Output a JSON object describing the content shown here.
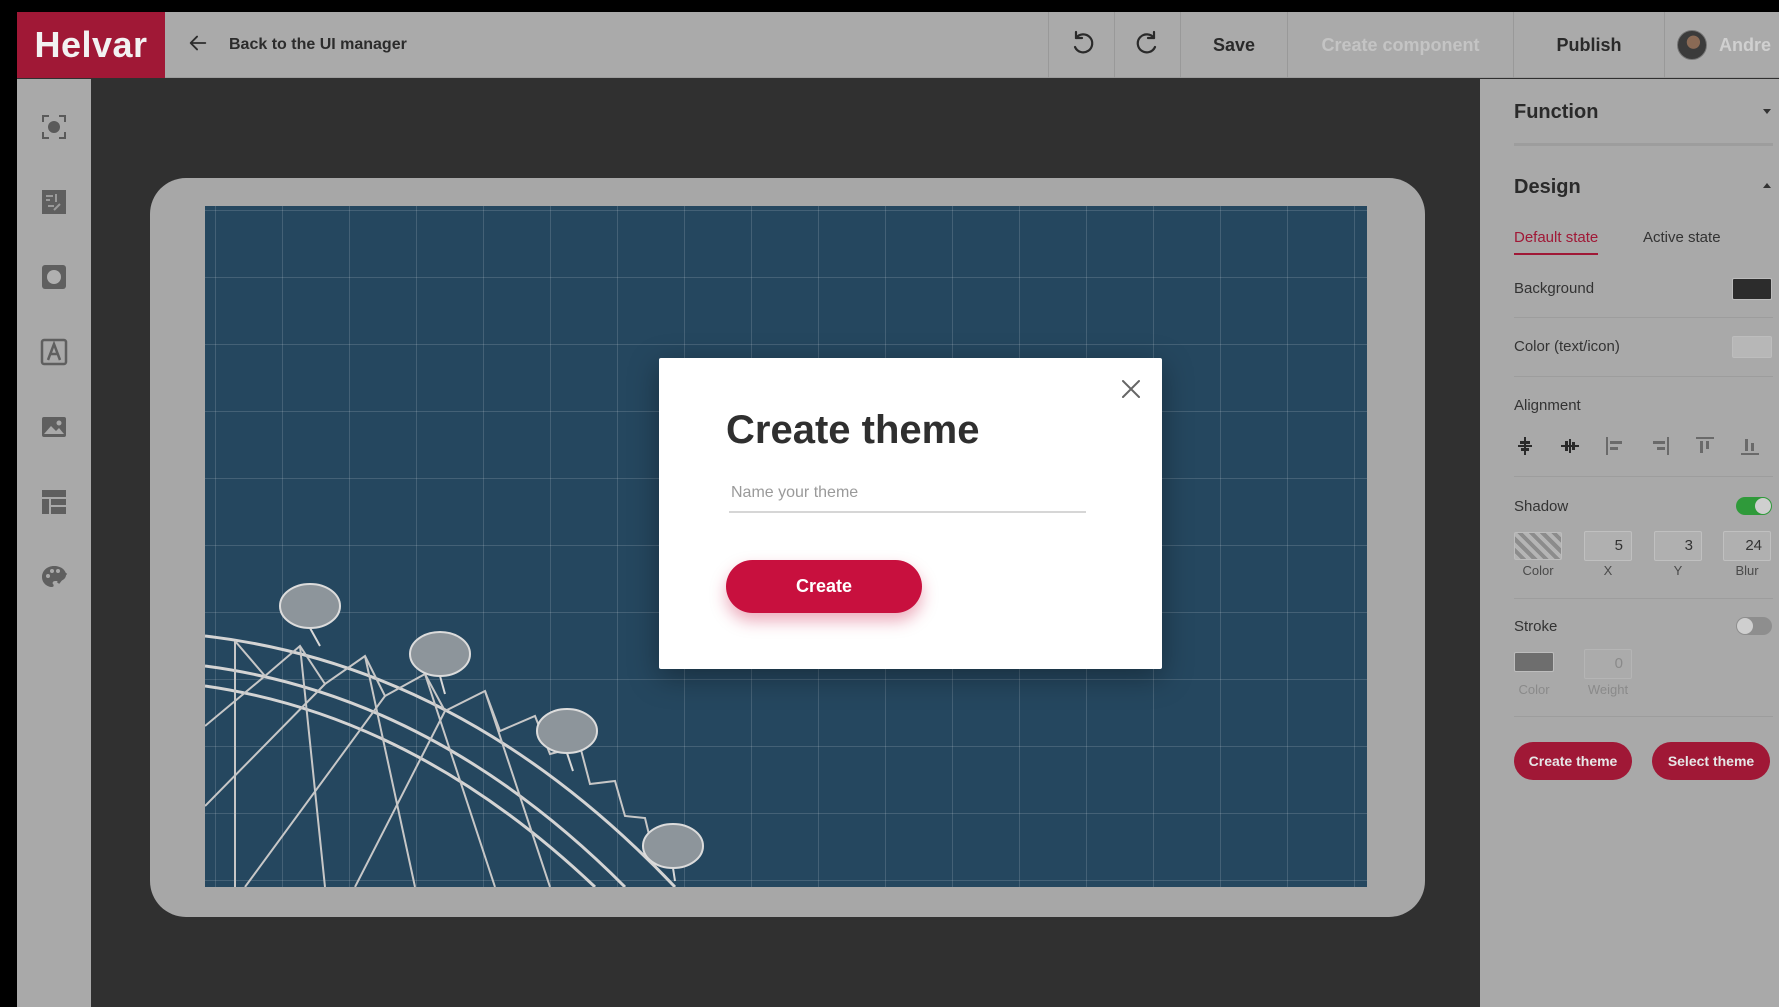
{
  "topbar": {
    "logo": "Helvar",
    "back_label": "Back to the UI manager",
    "save_label": "Save",
    "create_component_label": "Create component",
    "publish_label": "Publish",
    "user_name": "Andre"
  },
  "modal": {
    "title": "Create theme",
    "input_placeholder": "Name your theme",
    "input_value": "",
    "create_label": "Create"
  },
  "panel": {
    "function_heading": "Function",
    "design_heading": "Design",
    "tabs": {
      "default": "Default state",
      "active": "Active state"
    },
    "background_label": "Background",
    "color_label": "Color (text/icon)",
    "alignment_label": "Alignment",
    "shadow": {
      "label": "Shadow",
      "enabled": true,
      "x": "5",
      "y": "3",
      "blur": "24",
      "captions": {
        "color": "Color",
        "x": "X",
        "y": "Y",
        "blur": "Blur"
      }
    },
    "stroke": {
      "label": "Stroke",
      "enabled": false,
      "weight": "0",
      "captions": {
        "color": "Color",
        "weight": "Weight"
      }
    },
    "create_theme_label": "Create theme",
    "select_theme_label": "Select theme"
  },
  "colors": {
    "brand": "#c8103e",
    "brand_dimmed": "#a01836",
    "active_tab": "#a01836",
    "toggle_on": "#2f9a3a",
    "artboard": "#25475f"
  }
}
